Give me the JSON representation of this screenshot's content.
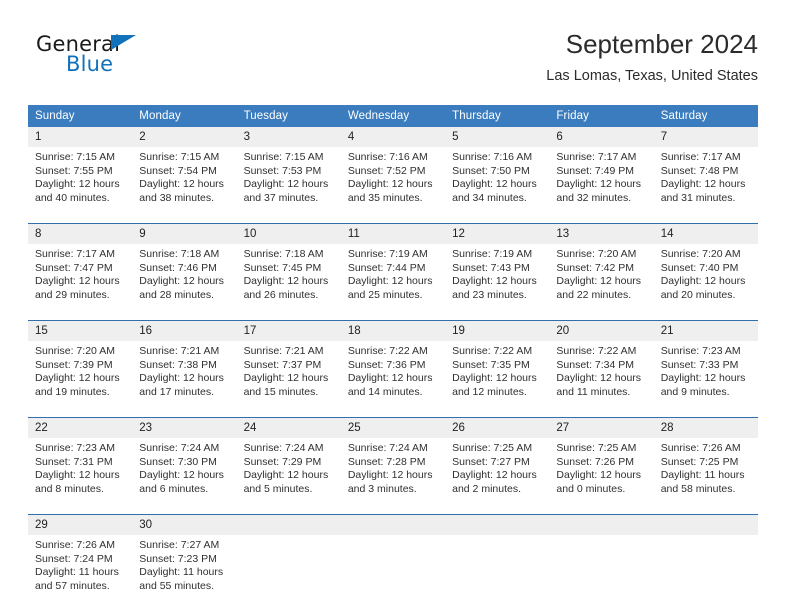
{
  "branding": {
    "name_part1": "General",
    "name_part2": "Blue",
    "accent_color": "#1271bb"
  },
  "header": {
    "title": "September 2024",
    "subtitle": "Las Lomas, Texas, United States"
  },
  "theme": {
    "header_row_bg": "#3a7cbe",
    "daynum_bg": "#efefef",
    "row_divider": "#2f6fae"
  },
  "weekdays": [
    "Sunday",
    "Monday",
    "Tuesday",
    "Wednesday",
    "Thursday",
    "Friday",
    "Saturday"
  ],
  "weeks": [
    [
      {
        "day": "1",
        "sunrise": "Sunrise: 7:15 AM",
        "sunset": "Sunset: 7:55 PM",
        "daylight1": "Daylight: 12 hours",
        "daylight2": "and 40 minutes."
      },
      {
        "day": "2",
        "sunrise": "Sunrise: 7:15 AM",
        "sunset": "Sunset: 7:54 PM",
        "daylight1": "Daylight: 12 hours",
        "daylight2": "and 38 minutes."
      },
      {
        "day": "3",
        "sunrise": "Sunrise: 7:15 AM",
        "sunset": "Sunset: 7:53 PM",
        "daylight1": "Daylight: 12 hours",
        "daylight2": "and 37 minutes."
      },
      {
        "day": "4",
        "sunrise": "Sunrise: 7:16 AM",
        "sunset": "Sunset: 7:52 PM",
        "daylight1": "Daylight: 12 hours",
        "daylight2": "and 35 minutes."
      },
      {
        "day": "5",
        "sunrise": "Sunrise: 7:16 AM",
        "sunset": "Sunset: 7:50 PM",
        "daylight1": "Daylight: 12 hours",
        "daylight2": "and 34 minutes."
      },
      {
        "day": "6",
        "sunrise": "Sunrise: 7:17 AM",
        "sunset": "Sunset: 7:49 PM",
        "daylight1": "Daylight: 12 hours",
        "daylight2": "and 32 minutes."
      },
      {
        "day": "7",
        "sunrise": "Sunrise: 7:17 AM",
        "sunset": "Sunset: 7:48 PM",
        "daylight1": "Daylight: 12 hours",
        "daylight2": "and 31 minutes."
      }
    ],
    [
      {
        "day": "8",
        "sunrise": "Sunrise: 7:17 AM",
        "sunset": "Sunset: 7:47 PM",
        "daylight1": "Daylight: 12 hours",
        "daylight2": "and 29 minutes."
      },
      {
        "day": "9",
        "sunrise": "Sunrise: 7:18 AM",
        "sunset": "Sunset: 7:46 PM",
        "daylight1": "Daylight: 12 hours",
        "daylight2": "and 28 minutes."
      },
      {
        "day": "10",
        "sunrise": "Sunrise: 7:18 AM",
        "sunset": "Sunset: 7:45 PM",
        "daylight1": "Daylight: 12 hours",
        "daylight2": "and 26 minutes."
      },
      {
        "day": "11",
        "sunrise": "Sunrise: 7:19 AM",
        "sunset": "Sunset: 7:44 PM",
        "daylight1": "Daylight: 12 hours",
        "daylight2": "and 25 minutes."
      },
      {
        "day": "12",
        "sunrise": "Sunrise: 7:19 AM",
        "sunset": "Sunset: 7:43 PM",
        "daylight1": "Daylight: 12 hours",
        "daylight2": "and 23 minutes."
      },
      {
        "day": "13",
        "sunrise": "Sunrise: 7:20 AM",
        "sunset": "Sunset: 7:42 PM",
        "daylight1": "Daylight: 12 hours",
        "daylight2": "and 22 minutes."
      },
      {
        "day": "14",
        "sunrise": "Sunrise: 7:20 AM",
        "sunset": "Sunset: 7:40 PM",
        "daylight1": "Daylight: 12 hours",
        "daylight2": "and 20 minutes."
      }
    ],
    [
      {
        "day": "15",
        "sunrise": "Sunrise: 7:20 AM",
        "sunset": "Sunset: 7:39 PM",
        "daylight1": "Daylight: 12 hours",
        "daylight2": "and 19 minutes."
      },
      {
        "day": "16",
        "sunrise": "Sunrise: 7:21 AM",
        "sunset": "Sunset: 7:38 PM",
        "daylight1": "Daylight: 12 hours",
        "daylight2": "and 17 minutes."
      },
      {
        "day": "17",
        "sunrise": "Sunrise: 7:21 AM",
        "sunset": "Sunset: 7:37 PM",
        "daylight1": "Daylight: 12 hours",
        "daylight2": "and 15 minutes."
      },
      {
        "day": "18",
        "sunrise": "Sunrise: 7:22 AM",
        "sunset": "Sunset: 7:36 PM",
        "daylight1": "Daylight: 12 hours",
        "daylight2": "and 14 minutes."
      },
      {
        "day": "19",
        "sunrise": "Sunrise: 7:22 AM",
        "sunset": "Sunset: 7:35 PM",
        "daylight1": "Daylight: 12 hours",
        "daylight2": "and 12 minutes."
      },
      {
        "day": "20",
        "sunrise": "Sunrise: 7:22 AM",
        "sunset": "Sunset: 7:34 PM",
        "daylight1": "Daylight: 12 hours",
        "daylight2": "and 11 minutes."
      },
      {
        "day": "21",
        "sunrise": "Sunrise: 7:23 AM",
        "sunset": "Sunset: 7:33 PM",
        "daylight1": "Daylight: 12 hours",
        "daylight2": "and 9 minutes."
      }
    ],
    [
      {
        "day": "22",
        "sunrise": "Sunrise: 7:23 AM",
        "sunset": "Sunset: 7:31 PM",
        "daylight1": "Daylight: 12 hours",
        "daylight2": "and 8 minutes."
      },
      {
        "day": "23",
        "sunrise": "Sunrise: 7:24 AM",
        "sunset": "Sunset: 7:30 PM",
        "daylight1": "Daylight: 12 hours",
        "daylight2": "and 6 minutes."
      },
      {
        "day": "24",
        "sunrise": "Sunrise: 7:24 AM",
        "sunset": "Sunset: 7:29 PM",
        "daylight1": "Daylight: 12 hours",
        "daylight2": "and 5 minutes."
      },
      {
        "day": "25",
        "sunrise": "Sunrise: 7:24 AM",
        "sunset": "Sunset: 7:28 PM",
        "daylight1": "Daylight: 12 hours",
        "daylight2": "and 3 minutes."
      },
      {
        "day": "26",
        "sunrise": "Sunrise: 7:25 AM",
        "sunset": "Sunset: 7:27 PM",
        "daylight1": "Daylight: 12 hours",
        "daylight2": "and 2 minutes."
      },
      {
        "day": "27",
        "sunrise": "Sunrise: 7:25 AM",
        "sunset": "Sunset: 7:26 PM",
        "daylight1": "Daylight: 12 hours",
        "daylight2": "and 0 minutes."
      },
      {
        "day": "28",
        "sunrise": "Sunrise: 7:26 AM",
        "sunset": "Sunset: 7:25 PM",
        "daylight1": "Daylight: 11 hours",
        "daylight2": "and 58 minutes."
      }
    ],
    [
      {
        "day": "29",
        "sunrise": "Sunrise: 7:26 AM",
        "sunset": "Sunset: 7:24 PM",
        "daylight1": "Daylight: 11 hours",
        "daylight2": "and 57 minutes."
      },
      {
        "day": "30",
        "sunrise": "Sunrise: 7:27 AM",
        "sunset": "Sunset: 7:23 PM",
        "daylight1": "Daylight: 11 hours",
        "daylight2": "and 55 minutes."
      },
      {
        "day": "",
        "sunrise": "",
        "sunset": "",
        "daylight1": "",
        "daylight2": ""
      },
      {
        "day": "",
        "sunrise": "",
        "sunset": "",
        "daylight1": "",
        "daylight2": ""
      },
      {
        "day": "",
        "sunrise": "",
        "sunset": "",
        "daylight1": "",
        "daylight2": ""
      },
      {
        "day": "",
        "sunrise": "",
        "sunset": "",
        "daylight1": "",
        "daylight2": ""
      },
      {
        "day": "",
        "sunrise": "",
        "sunset": "",
        "daylight1": "",
        "daylight2": ""
      }
    ]
  ]
}
